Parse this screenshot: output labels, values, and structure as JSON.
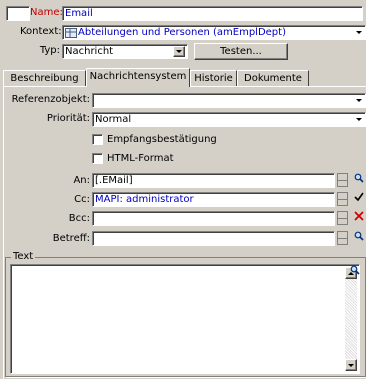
{
  "header": {
    "name_label": "Name:",
    "name_value": "Email",
    "kontext_label": "Kontext:",
    "kontext_value": "Abteilungen und Personen (amEmplDept)",
    "typ_label": "Typ:",
    "typ_value": "Nachricht",
    "test_button": "Testen..."
  },
  "tabs": [
    {
      "label": "Beschreibung"
    },
    {
      "label": "Nachrichtensystem"
    },
    {
      "label": "Historie"
    },
    {
      "label": "Dokumente"
    }
  ],
  "form": {
    "referenzobjekt_label": "Referenzobjekt:",
    "referenzobjekt_value": "",
    "prioritaet_label": "Priorität:",
    "prioritaet_value": "Normal",
    "empfang_label": "Empfangsbestätigung",
    "html_label": "HTML-Format",
    "an_label": "An:",
    "an_value": "[.EMail]",
    "cc_label": "Cc:",
    "cc_value": "MAPI: administrator",
    "bcc_label": "Bcc:",
    "bcc_value": "",
    "betreff_label": "Betreff:",
    "betreff_value": "",
    "text_group_label": "Text"
  },
  "colors": {
    "background": "#d4d0c8",
    "label_red": "#c00000",
    "value_blue": "#0000c0"
  }
}
